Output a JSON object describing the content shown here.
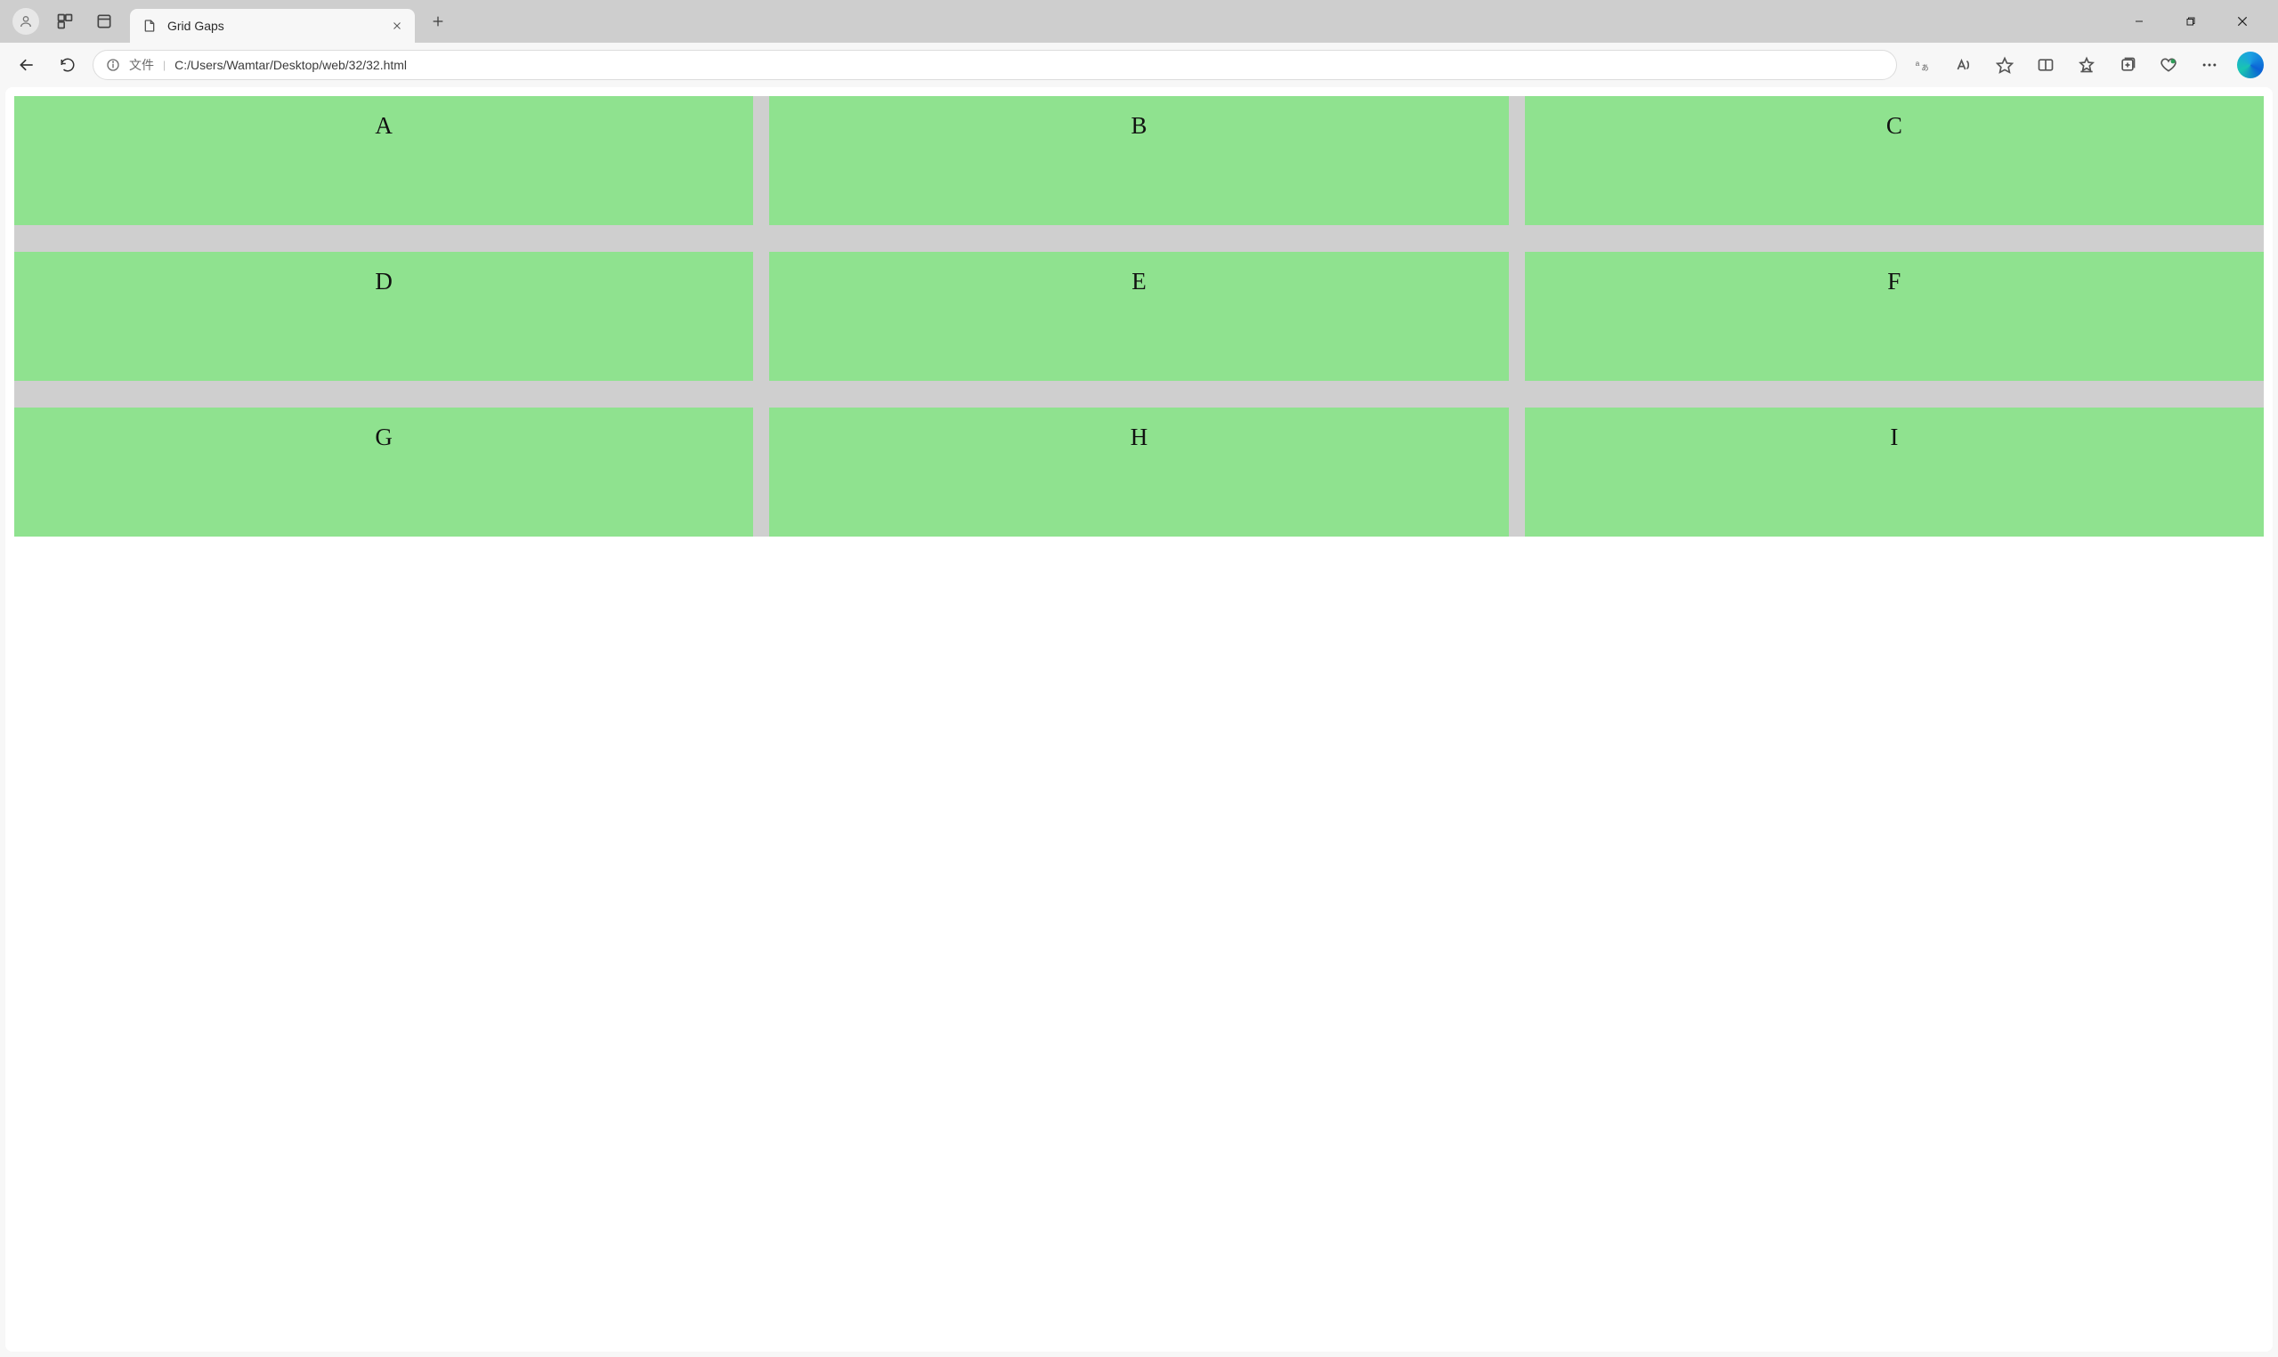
{
  "tab": {
    "title": "Grid Gaps"
  },
  "address": {
    "scheme_label": "文件",
    "url": "C:/Users/Wamtar/Desktop/web/32/32.html"
  },
  "grid": {
    "cells": [
      "A",
      "B",
      "C",
      "D",
      "E",
      "F",
      "G",
      "H",
      "I"
    ]
  }
}
